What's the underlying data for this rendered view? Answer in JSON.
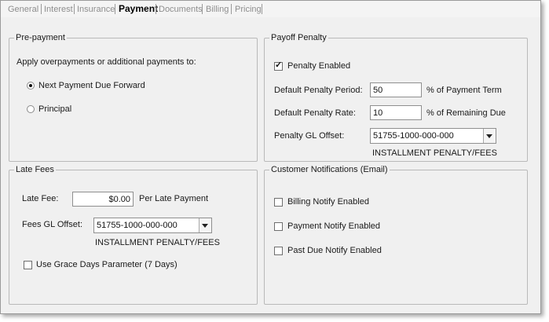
{
  "tabs": [
    "General",
    "Interest",
    "Insurance",
    "Payment",
    "Documents",
    "Billing",
    "Pricing"
  ],
  "active_tab": "Payment",
  "prepayment": {
    "title": "Pre-payment",
    "instruction": "Apply overpayments or additional payments to:",
    "options": [
      "Next Payment Due Forward",
      "Principal"
    ],
    "selected": "Next Payment Due Forward"
  },
  "payoff_penalty": {
    "title": "Payoff Penalty",
    "penalty_enabled_label": "Penalty Enabled",
    "penalty_enabled": true,
    "period_label": "Default Penalty Period:",
    "period_value": "50",
    "period_suffix": "% of Payment Term",
    "rate_label": "Default Penalty Rate:",
    "rate_value": "10",
    "rate_suffix": "% of Remaining Due",
    "gl_label": "Penalty GL Offset:",
    "gl_value": "51755-1000-000-000",
    "gl_description": "INSTALLMENT PENALTY/FEES"
  },
  "late_fees": {
    "title": "Late Fees",
    "fee_label": "Late Fee:",
    "fee_value": "$0.00",
    "fee_suffix": "Per Late Payment",
    "gl_label": "Fees GL Offset:",
    "gl_value": "51755-1000-000-000",
    "gl_description": "INSTALLMENT PENALTY/FEES",
    "grace_label": "Use Grace Days Parameter (7 Days)",
    "grace_checked": false
  },
  "notifications": {
    "title": "Customer Notifications (Email)",
    "items": [
      {
        "label": "Billing Notify Enabled",
        "checked": false
      },
      {
        "label": "Payment Notify Enabled",
        "checked": false
      },
      {
        "label": "Past Due Notify Enabled",
        "checked": false
      }
    ]
  }
}
